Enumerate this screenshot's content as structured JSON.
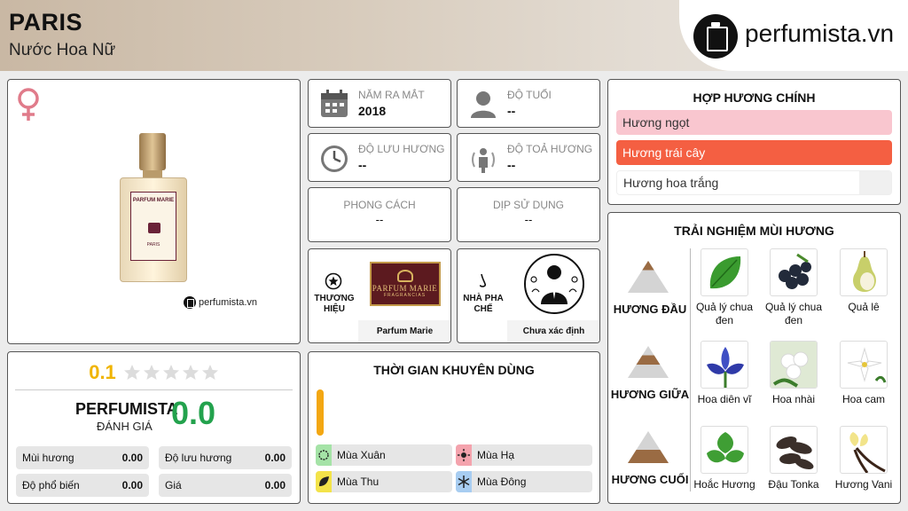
{
  "header": {
    "title": "PARIS",
    "subtitle": "Nước Hoa Nữ",
    "logo_text": "perfumista.vn"
  },
  "product": {
    "gender_icon": "venus-icon",
    "bottle_label_top": "PARFUM MARIE",
    "bottle_label_bottom": "PARIS",
    "watermark": "perfumista.vn"
  },
  "rating": {
    "user_score": "0.1",
    "stars_total": 5,
    "stars_filled": 0,
    "brand": "PERFUMISTA",
    "sub": "ĐÁNH GIÁ",
    "score": "0.0",
    "metrics": [
      {
        "label": "Mùi hương",
        "value": "0.00"
      },
      {
        "label": "Độ lưu hương",
        "value": "0.00"
      },
      {
        "label": "Độ phổ biến",
        "value": "0.00"
      },
      {
        "label": "Giá",
        "value": "0.00"
      }
    ]
  },
  "info": {
    "year": {
      "label": "NĂM RA MẮT",
      "value": "2018",
      "icon": "calendar-icon"
    },
    "age": {
      "label": "ĐỘ TUỔI",
      "value": "--",
      "icon": "person-icon"
    },
    "longevity": {
      "label": "ĐỘ LƯU HƯƠNG",
      "value": "--",
      "icon": "clock-icon"
    },
    "sillage": {
      "label": "ĐỘ TOẢ HƯƠNG",
      "value": "--",
      "icon": "sillage-icon"
    },
    "style": {
      "label": "PHONG CÁCH",
      "value": "--"
    },
    "occasion": {
      "label": "DỊP SỬ DỤNG",
      "value": "--"
    }
  },
  "brand": {
    "label": "THƯƠNG HIỆU",
    "name": "Parfum Marie",
    "logo_text": "PARFUM MARIE",
    "logo_tag": "FRAGRANCIAS"
  },
  "perfumer": {
    "label": "NHÀ PHA CHẾ",
    "name": "Chưa xác định"
  },
  "time": {
    "title": "THỜI GIAN KHUYÊN DÙNG",
    "seasons": [
      {
        "label": "Mùa Xuân",
        "color": "#a5e3a7",
        "icon": "spring-icon"
      },
      {
        "label": "Mùa Hạ",
        "color": "#f4a3ad",
        "icon": "sun-icon"
      },
      {
        "label": "Mùa Thu",
        "color": "#f3e34a",
        "icon": "leaf-icon"
      },
      {
        "label": "Mùa Đông",
        "color": "#a8cdf1",
        "icon": "snowflake-icon"
      }
    ]
  },
  "accords": {
    "title": "HỢP HƯƠNG CHÍNH",
    "items": [
      {
        "label": "Hương ngọt",
        "color": "#f9c6cf"
      },
      {
        "label": "Hương trái cây",
        "color": "#f45f42"
      },
      {
        "label": "Hương hoa trắng",
        "color": "#f0f0f0"
      }
    ]
  },
  "notes": {
    "title": "TRẢI NGHIỆM MÙI HƯƠNG",
    "tiers": [
      {
        "label": "HƯƠNG ĐẦU",
        "items": [
          "Quả lý chua đen",
          "Quả lý chua đen",
          "Quả lê"
        ]
      },
      {
        "label": "HƯƠNG GIỮA",
        "items": [
          "Hoa diên vĩ",
          "Hoa nhài",
          "Hoa cam"
        ]
      },
      {
        "label": "HƯƠNG CUỐI",
        "items": [
          "Hoắc Hương",
          "Đậu Tonka",
          "Hương Vani"
        ]
      }
    ]
  }
}
